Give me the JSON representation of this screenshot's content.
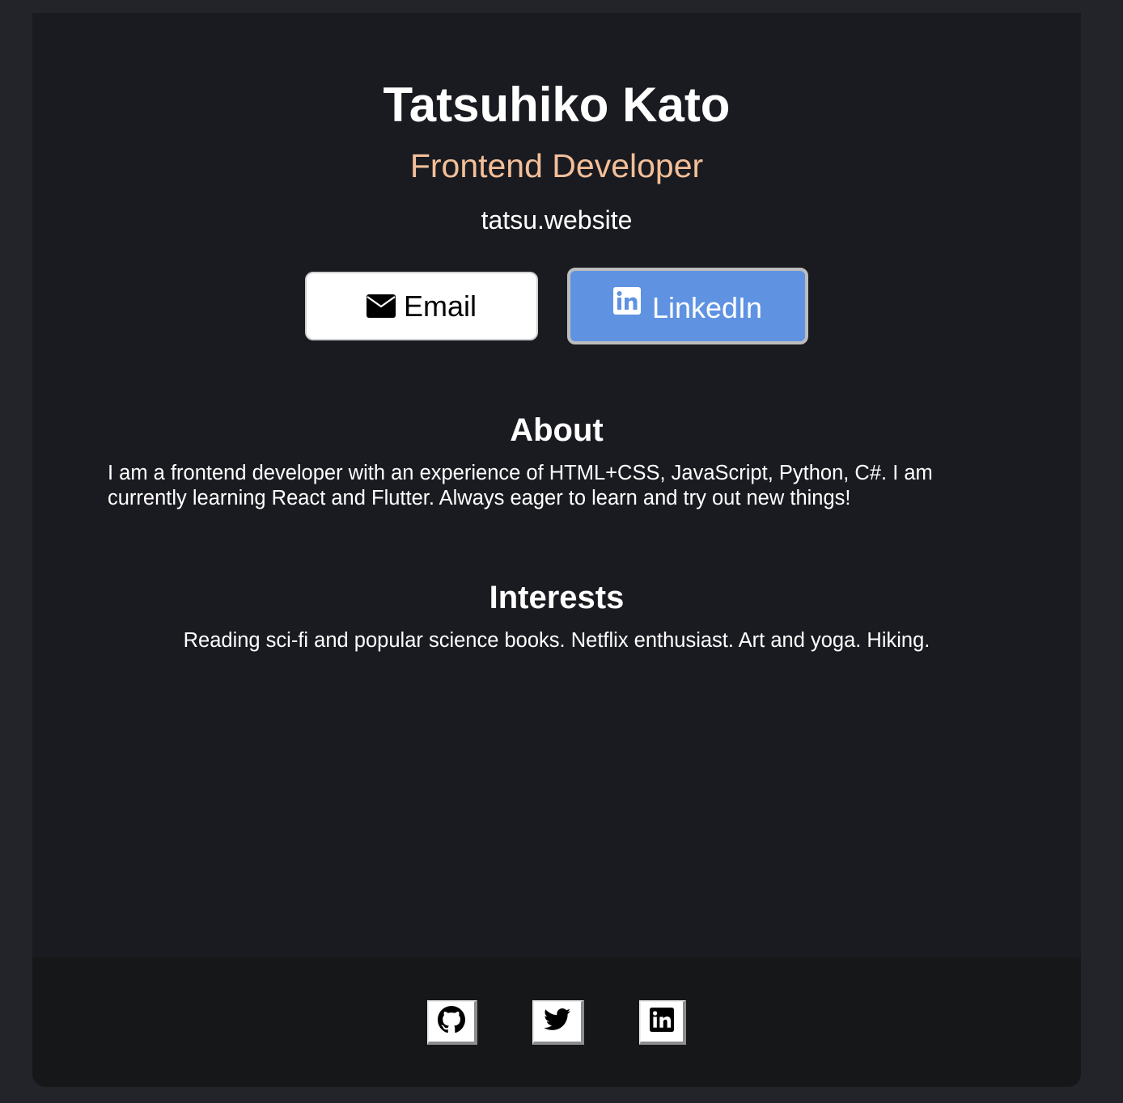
{
  "profile": {
    "name": "Tatsuhiko Kato",
    "role": "Frontend Developer",
    "website": "tatsu.website"
  },
  "buttons": {
    "email_label": "Email",
    "email_icon": "envelope-icon",
    "linkedin_label": "LinkedIn",
    "linkedin_icon": "linkedin-icon"
  },
  "about": {
    "title": "About",
    "text": "I am a frontend developer with an experience of HTML+CSS, JavaScript, Python, C#. I am currently learning React and Flutter. Always eager to learn and try out new things!"
  },
  "interests": {
    "title": "Interests",
    "text": "Reading sci-fi and popular science books. Netflix enthusiast. Art and yoga. Hiking."
  },
  "footer": {
    "social_icons": [
      "github-icon",
      "twitter-icon",
      "linkedin-icon"
    ]
  },
  "colors": {
    "page_background": "#23242a",
    "card_background": "#1a1b20",
    "footer_background": "#161719",
    "role_accent": "#f3bf99",
    "linkedin_button": "#5f93e2",
    "text": "#ffffff"
  }
}
